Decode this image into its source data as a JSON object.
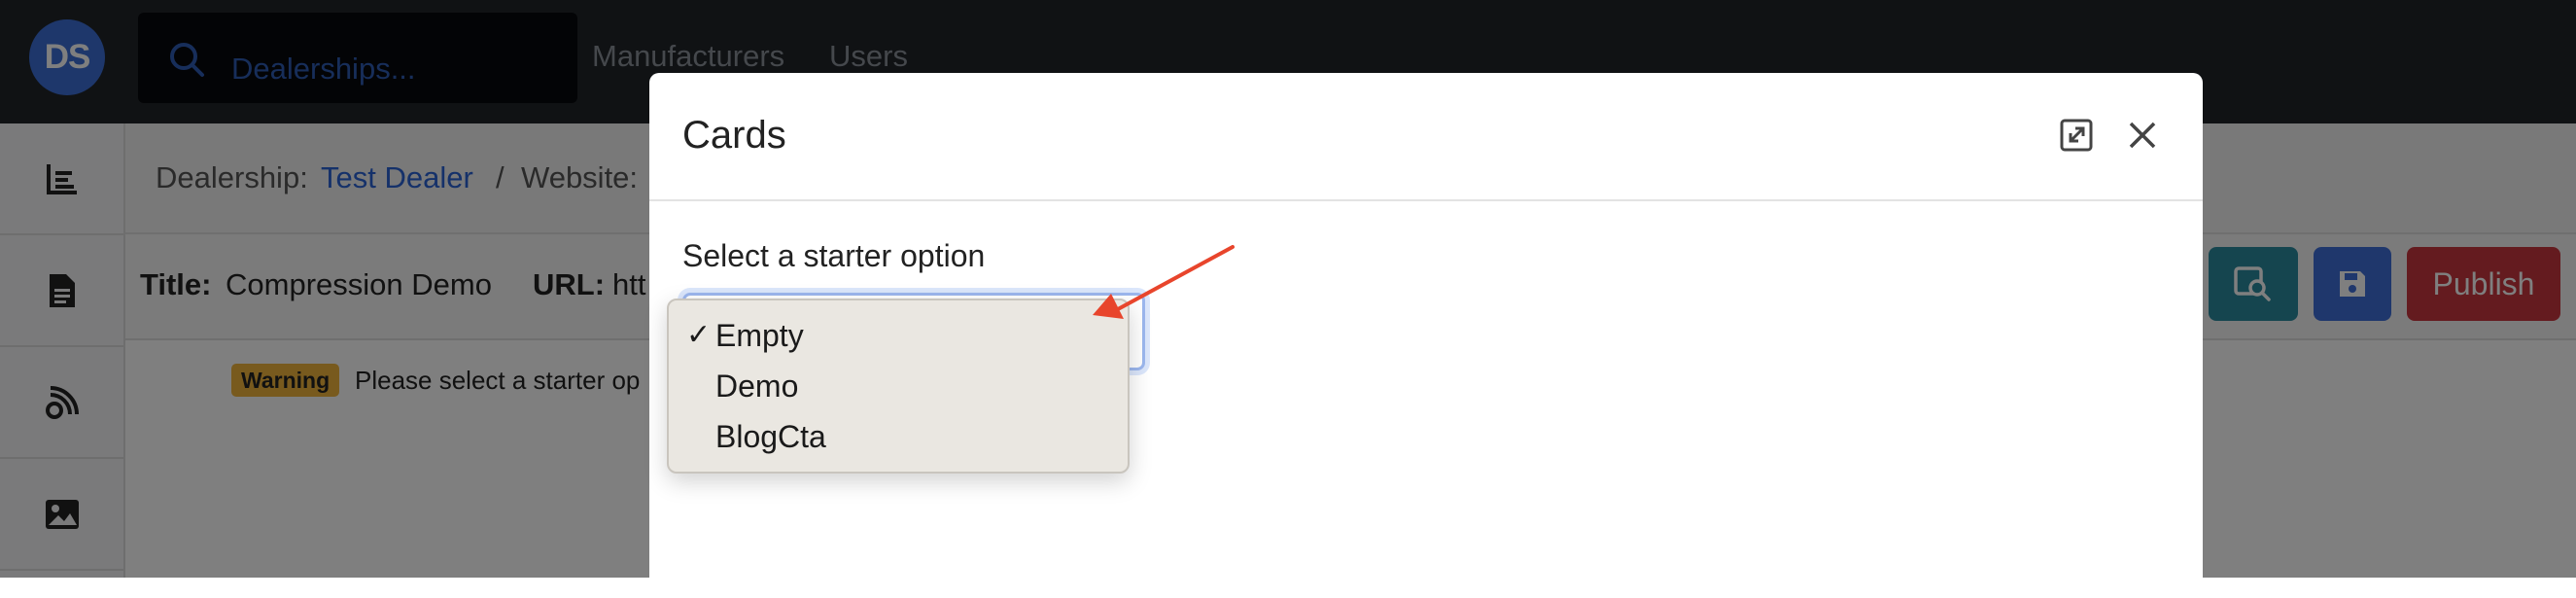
{
  "navbar": {
    "avatar_initials": "DS",
    "search_placeholder": "Dealerships...",
    "links": [
      "Manufacturers",
      "Users"
    ]
  },
  "sidebar": {
    "items": [
      "chart-icon",
      "document-icon",
      "blog-icon",
      "image-icon"
    ]
  },
  "breadcrumb": {
    "dealership_label": "Dealership:",
    "dealership_name": "Test Dealer",
    "separator": "/",
    "website_label": "Website:"
  },
  "page": {
    "title_label": "Title:",
    "title_value": "Compression Demo",
    "url_label": "URL:",
    "url_value": "htt",
    "publish_label": "Publish",
    "warning_badge": "Warning",
    "warning_text": "Please select a starter op"
  },
  "modal": {
    "title": "Cards",
    "field_label": "Select a starter option",
    "selected_option": "Empty",
    "options": [
      "Empty",
      "Demo",
      "BlogCta"
    ],
    "checkmark": "✓"
  },
  "colors": {
    "navbar_bg": "#212529",
    "accent_blue": "#2b63d5",
    "teal_button": "#2b8a9e",
    "save_button": "#3f6fd9",
    "publish_button": "#c9363f",
    "warning": "#f0b43c",
    "annotation_arrow": "#e8452c"
  }
}
